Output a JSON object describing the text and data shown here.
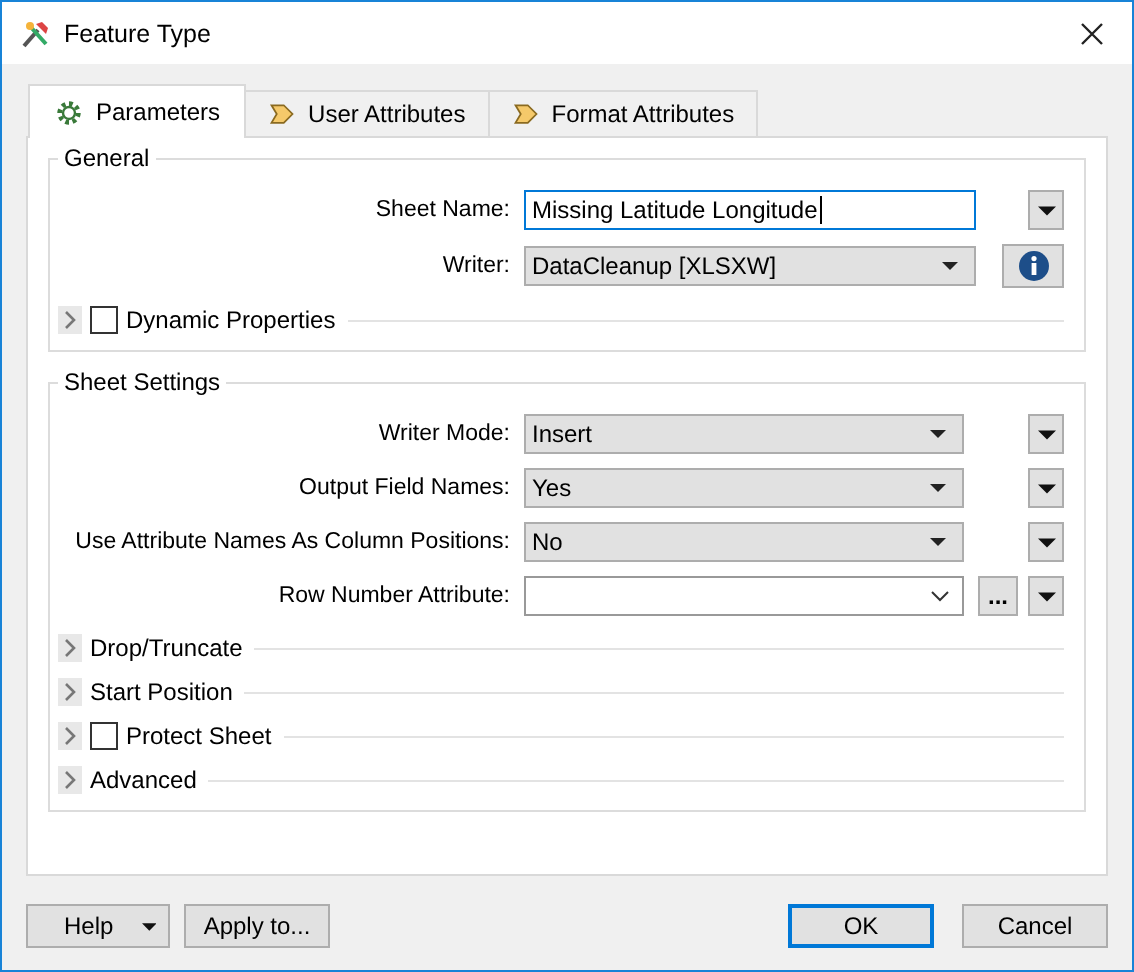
{
  "window": {
    "title": "Feature Type"
  },
  "tabs": [
    {
      "label": "Parameters",
      "kind": "gear",
      "selected": true
    },
    {
      "label": "User Attributes",
      "kind": "arrow",
      "selected": false
    },
    {
      "label": "Format Attributes",
      "kind": "arrow",
      "selected": false
    }
  ],
  "groups": [
    {
      "title": "General",
      "fields": [
        {
          "label": "Sheet Name:",
          "kind": "text",
          "value": "Missing Latitude Longitude",
          "extras": [
            {
              "kind": "menu"
            }
          ]
        },
        {
          "label": "Writer:",
          "kind": "dropdown",
          "value": "DataCleanup [XLSXW]",
          "extras": [
            {
              "kind": "info"
            }
          ]
        }
      ],
      "sections": [
        {
          "label": "Dynamic Properties",
          "kind": "checkbox",
          "checked": false
        }
      ]
    },
    {
      "title": "Sheet Settings",
      "fields": [
        {
          "label": "Writer Mode:",
          "kind": "dropdown",
          "value": "Insert",
          "extras": [
            {
              "kind": "menu"
            }
          ]
        },
        {
          "label": "Output Field Names:",
          "kind": "dropdown",
          "value": "Yes",
          "extras": [
            {
              "kind": "menu"
            }
          ]
        },
        {
          "label": "Use Attribute Names As Column Positions:",
          "kind": "dropdown",
          "value": "No",
          "extras": [
            {
              "kind": "menu"
            }
          ]
        },
        {
          "label": "Row Number Attribute:",
          "kind": "combo",
          "extras": [
            {
              "kind": "ellipsis",
              "label": "..."
            },
            {
              "kind": "menu"
            }
          ]
        }
      ],
      "sections": [
        {
          "label": "Drop/Truncate",
          "kind": "plain"
        },
        {
          "label": "Start Position",
          "kind": "plain"
        },
        {
          "label": "Protect Sheet",
          "kind": "checkbox",
          "checked": false
        },
        {
          "label": "Advanced",
          "kind": "plain"
        }
      ]
    }
  ],
  "buttons": [
    {
      "label": "Help",
      "kind": "split"
    },
    {
      "label": "Apply to...",
      "kind": "plain"
    },
    {
      "label": "OK",
      "kind": "default"
    },
    {
      "label": "Cancel",
      "kind": "plain"
    }
  ]
}
